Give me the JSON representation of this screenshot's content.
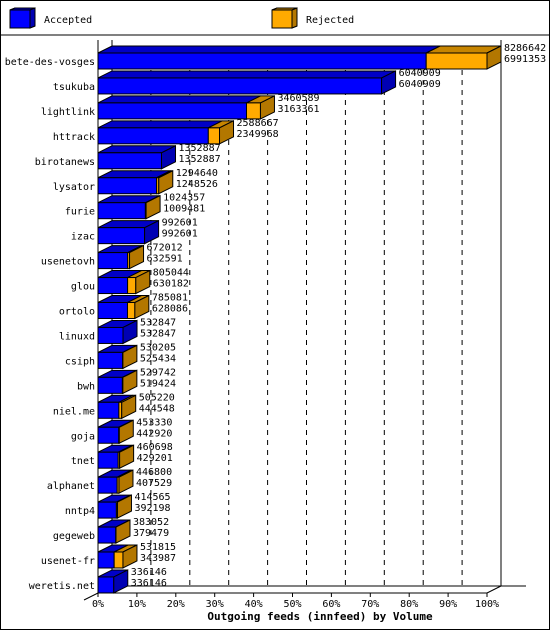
{
  "chart_data": {
    "type": "bar",
    "orientation": "horizontal",
    "stacked": true,
    "three_d": true,
    "title": "",
    "xlabel": "Outgoing feeds (innfeed) by Volume",
    "ylabel": "",
    "xlim": [
      0,
      100
    ],
    "x_unit": "%",
    "x_ticks": [
      "0%",
      "10%",
      "20%",
      "30%",
      "40%",
      "50%",
      "60%",
      "70%",
      "80%",
      "90%",
      "100%"
    ],
    "grid": "vertical dashed",
    "legend_position": "top",
    "max_total": 8286642,
    "categories": [
      "bete-des-vosges",
      "tsukuba",
      "lightlink",
      "httrack",
      "birotanews",
      "lysator",
      "furie",
      "izac",
      "usenetovh",
      "glou",
      "ortolo",
      "linuxd",
      "csiph",
      "bwh",
      "niel.me",
      "goja",
      "tnet",
      "alphanet",
      "nntp4",
      "gegeweb",
      "usenet-fr",
      "weretis.net"
    ],
    "totals": [
      8286642,
      6040909,
      3460589,
      2588667,
      1352887,
      1294640,
      1024357,
      992601,
      672012,
      805044,
      785081,
      532847,
      530205,
      529742,
      505220,
      453330,
      460698,
      446800,
      414565,
      383052,
      531815,
      336146
    ],
    "series": [
      {
        "name": "Accepted",
        "color": "#0000ff",
        "values": [
          6991353,
          6040909,
          3163361,
          2349968,
          1352887,
          1248526,
          1009481,
          992601,
          632591,
          630182,
          628086,
          532847,
          525434,
          519424,
          444548,
          442920,
          429201,
          407529,
          392198,
          379479,
          343987,
          336146
        ]
      },
      {
        "name": "Rejected",
        "color": "#ffaa00",
        "values": [
          1295289,
          0,
          297228,
          238699,
          0,
          46114,
          14876,
          0,
          39421,
          174862,
          156995,
          0,
          4771,
          10318,
          60672,
          10410,
          31497,
          39271,
          22367,
          3573,
          187828,
          0
        ]
      }
    ]
  },
  "legend": {
    "items": [
      {
        "label": "Accepted",
        "color": "#0000ff"
      },
      {
        "label": "Rejected",
        "color": "#ffaa00"
      }
    ]
  }
}
